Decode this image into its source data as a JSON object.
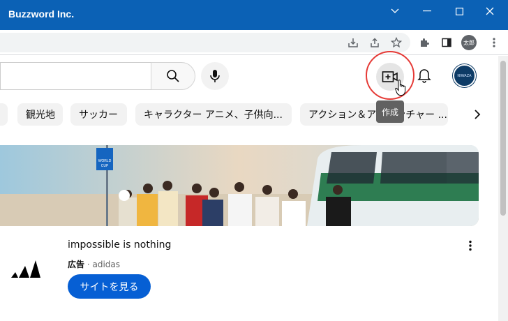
{
  "window": {
    "title": "Buzzword Inc."
  },
  "browser": {
    "profile_label": "太郎"
  },
  "header": {
    "create_tooltip": "作成",
    "avatar_text": "NIWAZA"
  },
  "chips": [
    "観光地",
    "サッカー",
    "キャラクター アニメ、子供向...",
    "アクション＆アドベンチャー ..."
  ],
  "ad": {
    "title": "impossible is nothing",
    "label": "広告",
    "advertiser": "adidas",
    "cta": "サイトを見る",
    "sign_text": [
      "WORLD",
      "CUP"
    ]
  },
  "colors": {
    "titlebar": "#0b61b5",
    "cta": "#065fd4",
    "highlight_circle": "#e53935",
    "tooltip": "#616161"
  }
}
